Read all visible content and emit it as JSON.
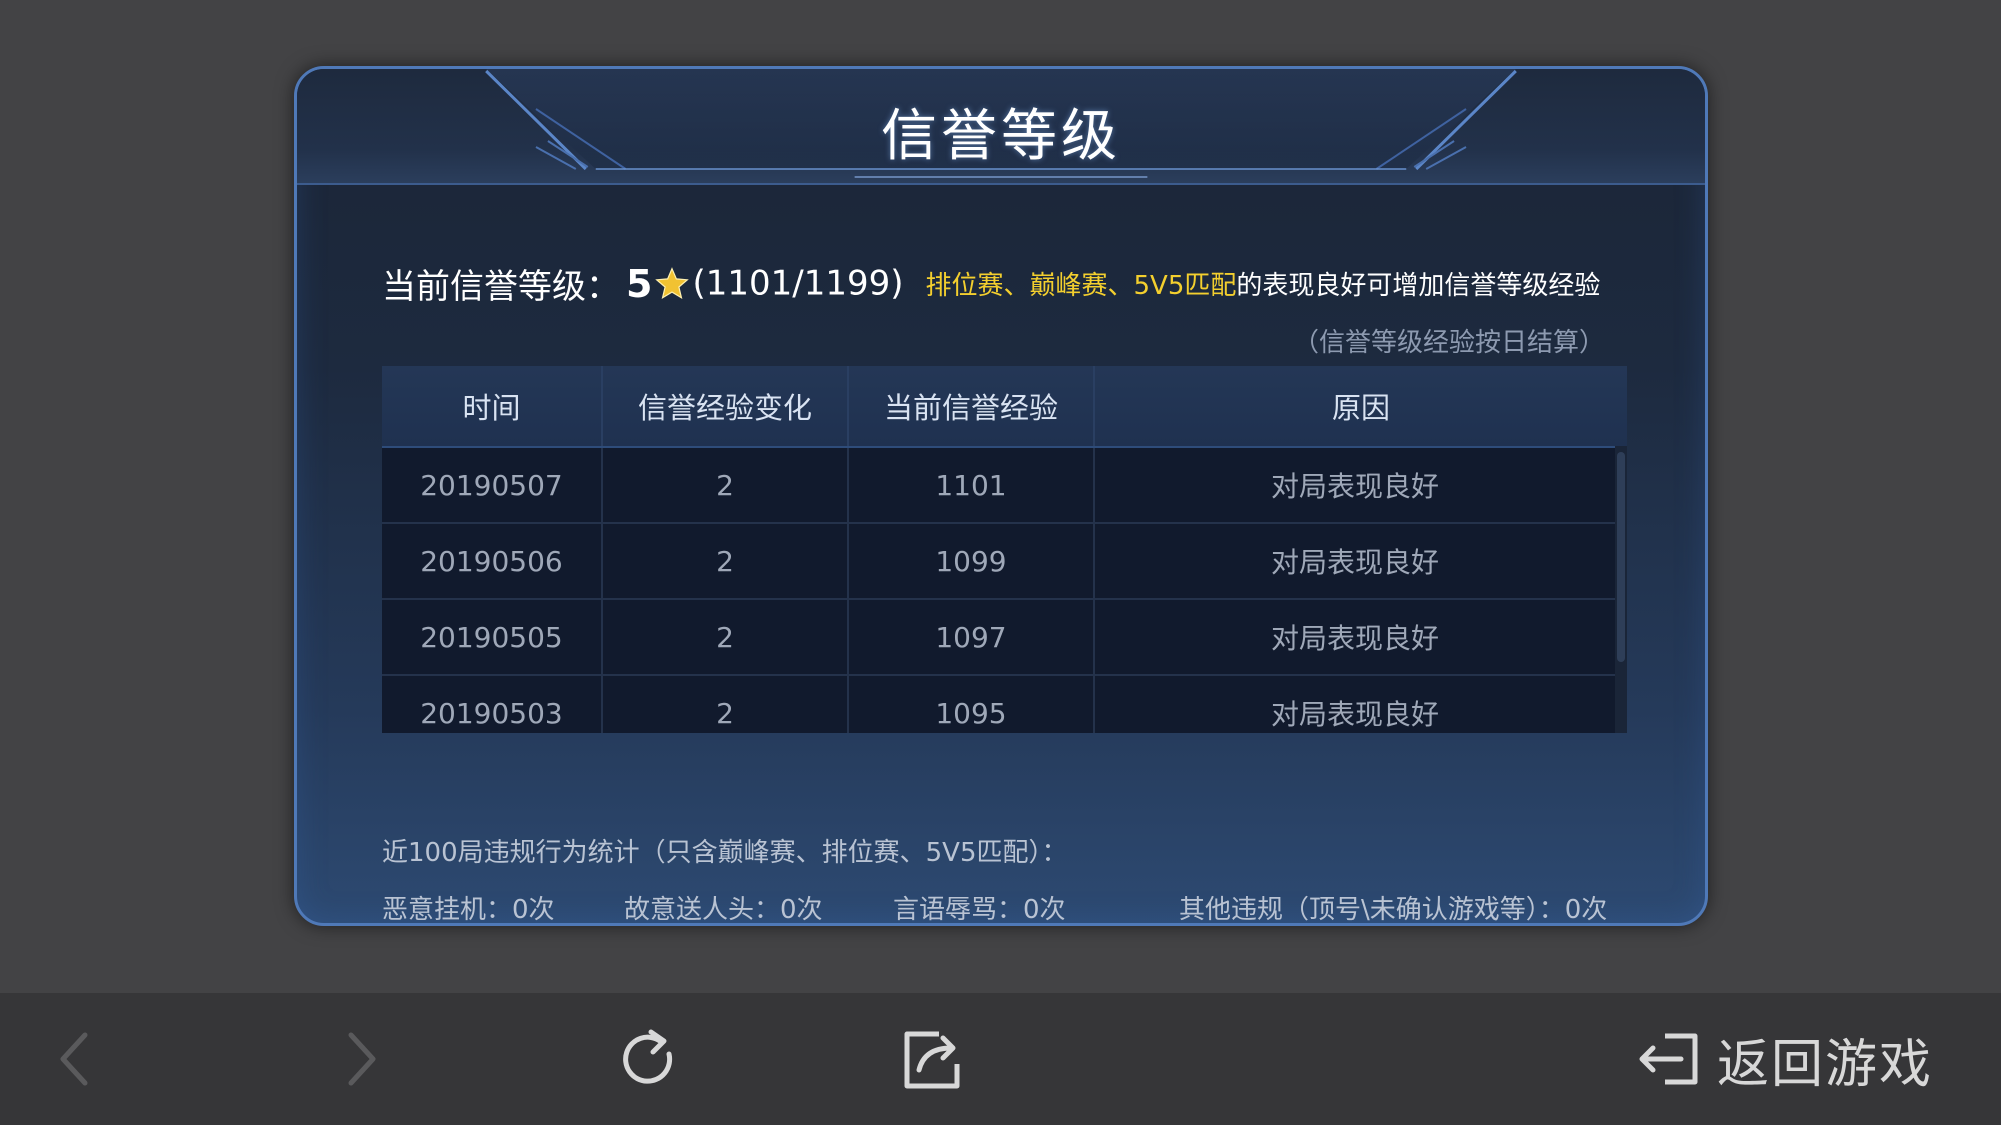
{
  "panel": {
    "title": "信誉等级"
  },
  "level": {
    "label": "当前信誉等级：",
    "value": "5",
    "progress": "(1101/1199)",
    "note_highlight": "排位赛、巅峰赛、5V5匹配",
    "note_rest": "的表现良好可增加信誉等级经验",
    "settle_note": "（信誉等级经验按日结算）"
  },
  "table": {
    "headers": [
      "时间",
      "信誉经验变化",
      "当前信誉经验",
      "原因"
    ],
    "rows": [
      [
        "20190507",
        "2",
        "1101",
        "对局表现良好"
      ],
      [
        "20190506",
        "2",
        "1099",
        "对局表现良好"
      ],
      [
        "20190505",
        "2",
        "1097",
        "对局表现良好"
      ],
      [
        "20190503",
        "2",
        "1095",
        "对局表现良好"
      ]
    ]
  },
  "stats": {
    "title": "近100局违规行为统计（只含巅峰赛、排位赛、5V5匹配）：",
    "afk": "恶意挂机：0次",
    "feeding": "故意送人头：0次",
    "abuse": "言语辱骂：0次",
    "other": "其他违规（顶号\\未确认游戏等）：0次"
  },
  "bottom_bar": {
    "return_label": "返回游戏"
  },
  "colors": {
    "highlight": "#f3cf2e",
    "panel_border": "#4f79b8"
  }
}
